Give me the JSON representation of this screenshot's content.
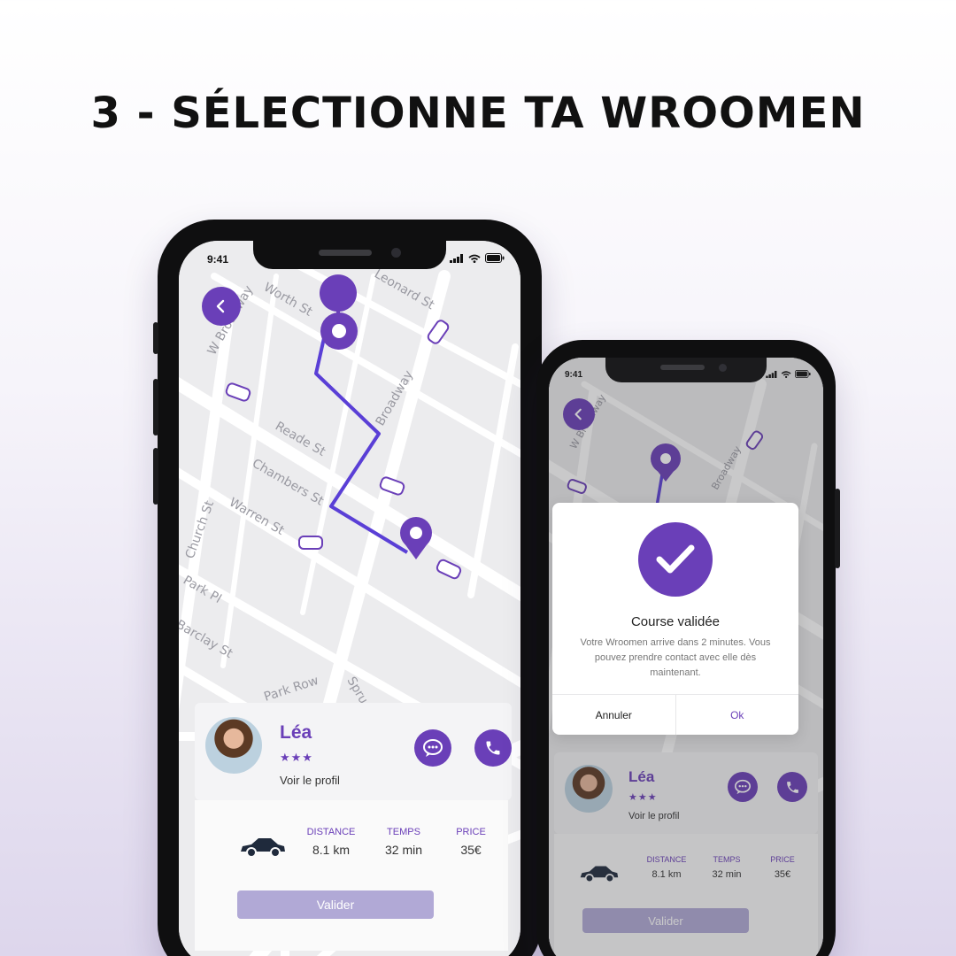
{
  "headline": "3 - SÉLECTIONNE TA WROOMEN",
  "colors": {
    "accent": "#6a3fb8",
    "button_disabled": "#b1a9d6"
  },
  "phone_main": {
    "status": {
      "time": "9:41"
    },
    "map_labels": [
      "W Broadway",
      "Worth St",
      "Leonard St",
      "Broadway",
      "Reade St",
      "Chambers St",
      "Warren St",
      "Church St",
      "Park Pl",
      "Barclay St",
      "Park Row",
      "Spruce St"
    ],
    "driver": {
      "name": "Léa",
      "stars": "★★★",
      "profile_link": "Voir le profil"
    },
    "trip": {
      "distance_label": "DISTANCE",
      "distance_value": "8.1 km",
      "time_label": "TEMPS",
      "time_value": "32 min",
      "price_label": "PRICE",
      "price_value": "35€"
    },
    "validate_label": "Valider"
  },
  "phone_secondary": {
    "status": {
      "time": "9:41"
    },
    "dialog": {
      "title": "Course validée",
      "message": "Votre Wroomen arrive dans 2 minutes. Vous pouvez prendre contact avec elle dès maintenant.",
      "cancel_label": "Annuler",
      "ok_label": "Ok"
    },
    "driver": {
      "name": "Léa",
      "stars": "★★★",
      "profile_link": "Voir le profil"
    },
    "trip": {
      "distance_label": "DISTANCE",
      "distance_value": "8.1 km",
      "time_label": "TEMPS",
      "time_value": "32 min",
      "price_label": "PRICE",
      "price_value": "35€"
    },
    "validate_label": "Valider"
  },
  "icons": [
    "back-arrow-icon",
    "chat-icon",
    "phone-icon",
    "car-icon",
    "location-pin-icon",
    "checkmark-icon",
    "signal-icon",
    "wifi-icon",
    "battery-icon"
  ]
}
